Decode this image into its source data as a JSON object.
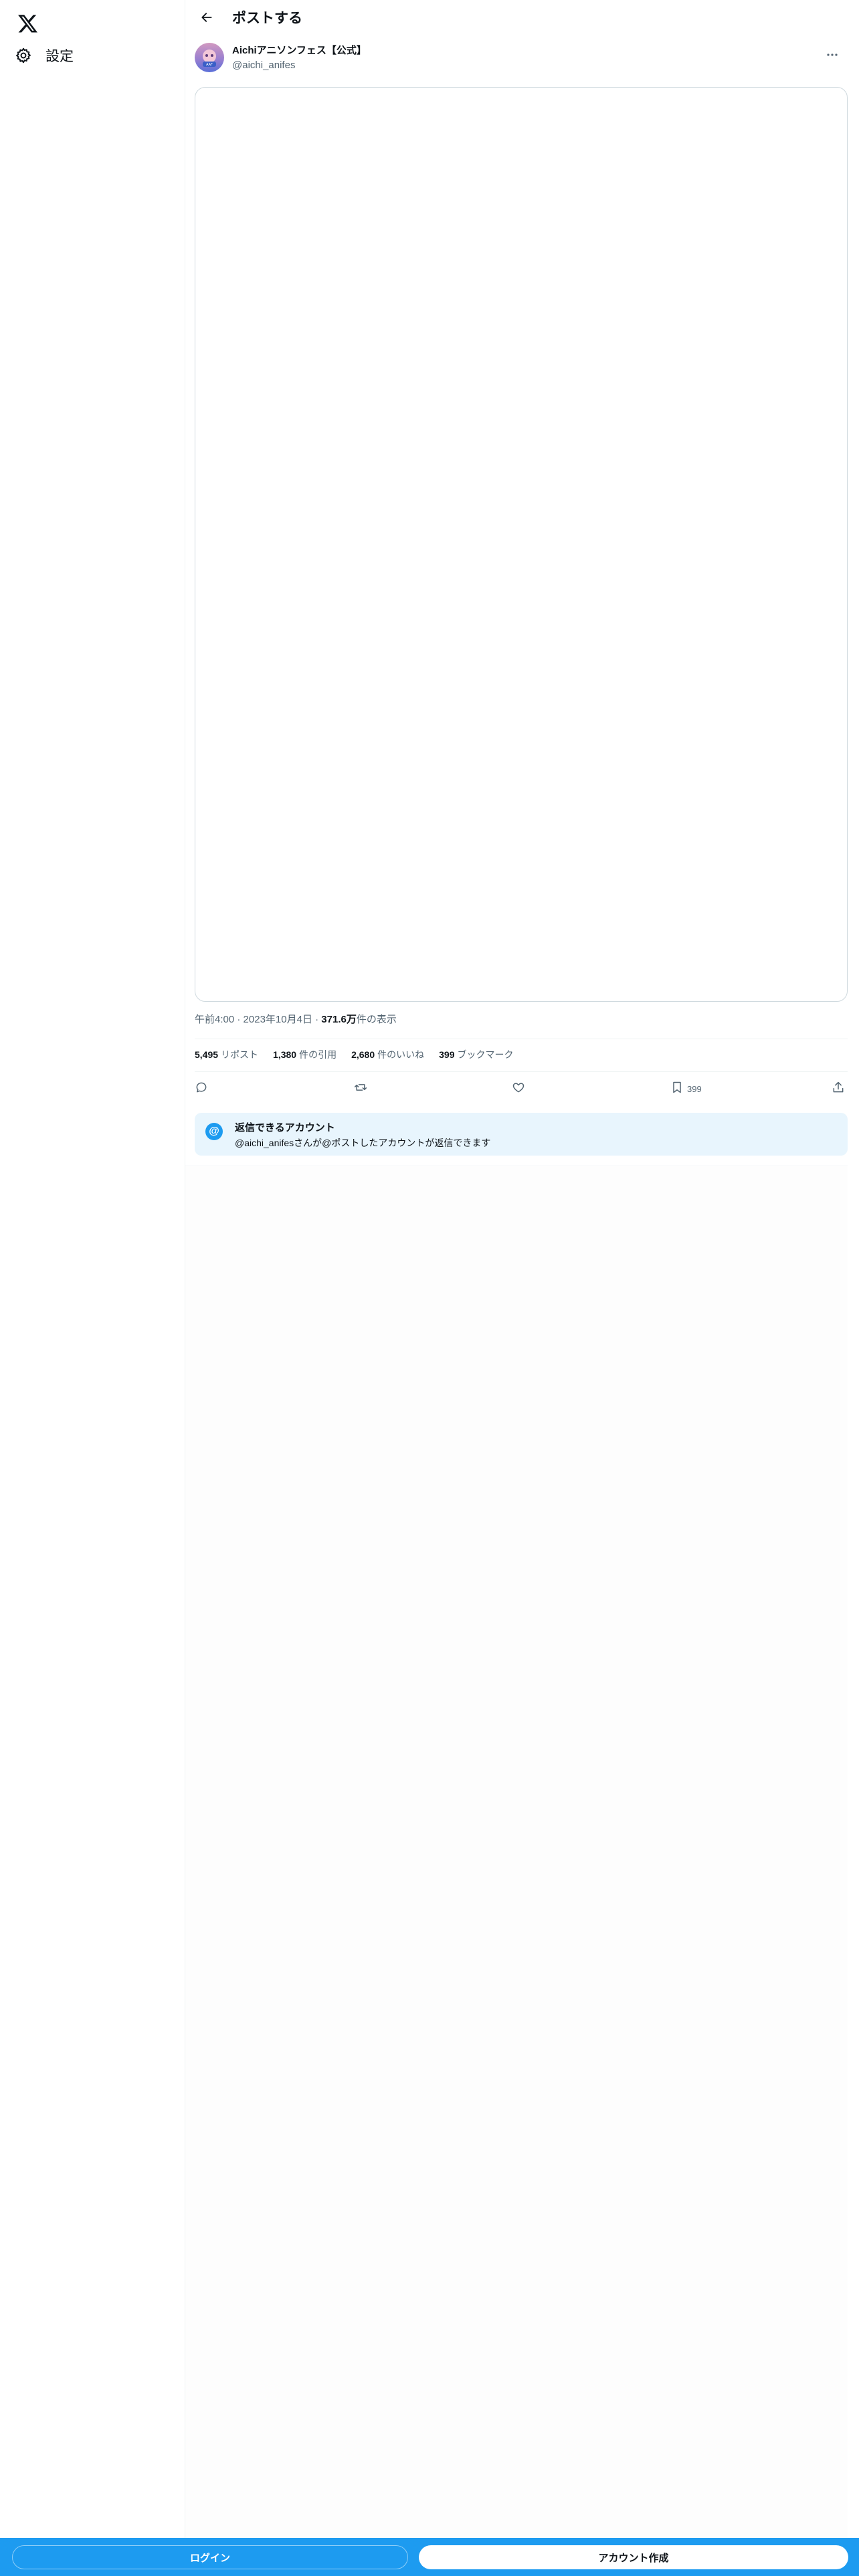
{
  "sidebar": {
    "logo_icon": "x-logo-icon",
    "items": [
      {
        "label": "設定",
        "icon": "gear-icon"
      }
    ]
  },
  "header": {
    "title": "ポストする",
    "back_icon": "arrow-left-icon"
  },
  "post": {
    "author_name": "Aichiアニソンフェス【公式】",
    "author_handle": "@aichi_anifes",
    "time": "午前4:00",
    "date": "2023年10月4日",
    "views_count": "371.6万",
    "views_label": "件の表示",
    "separator": "·"
  },
  "stats": {
    "reposts_count": "5,495",
    "reposts_label": "リポスト",
    "quotes_count": "1,380",
    "quotes_label": "件の引用",
    "likes_count": "2,680",
    "likes_label": "件のいいね",
    "bookmarks_count": "399",
    "bookmarks_label": "ブックマーク"
  },
  "actions": {
    "bookmark_count": "399"
  },
  "reply_restriction": {
    "icon_glyph": "@",
    "title": "返信できるアカウント",
    "description": "@aichi_anifesさんが@ポストしたアカウントが返信できます"
  },
  "bottom_bar": {
    "login_label": "ログイン",
    "signup_label": "アカウント作成"
  },
  "colors": {
    "accent": "#1d9bf0",
    "text_primary": "#0f1419",
    "text_secondary": "#536471",
    "reply_card_bg": "#e8f5fd",
    "border": "#cfd9de"
  }
}
